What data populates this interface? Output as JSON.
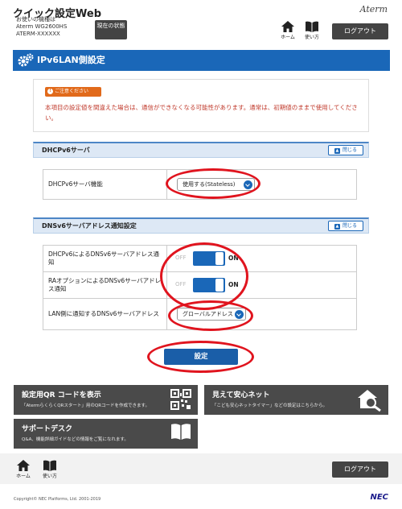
{
  "header": {
    "app_title": "クイック設定Web",
    "device_label": "お使いの機種は",
    "device_model": "Aterm WG2600HS",
    "device_id": "ATERM-XXXXXX",
    "status_button": "現在の状態",
    "brand": "Aterm",
    "home_label": "ホーム",
    "help_label": "使い方",
    "logout_label": "ログアウト"
  },
  "page_title": "IPv6LAN側設定",
  "caution": {
    "tag": "ご注意ください",
    "text": "本項目の設定値を間違えた場合は、通信ができなくなる可能性があります。通常は、初期値のままで使用してください。"
  },
  "dhcpv6": {
    "section_title": "DHCPv6サーバ",
    "close_label": "閉じる",
    "function_label": "DHCPv6サーバ機能",
    "function_value": "使用する(Stateless)"
  },
  "dnsv6": {
    "section_title": "DNSv6サーバアドレス通知設定",
    "close_label": "閉じる",
    "rows": [
      {
        "label": "DHCPv6によるDNSv6サーバアドレス通知",
        "off": "OFF",
        "on": "ON"
      },
      {
        "label": "RAオプションによるDNSv6サーバアドレス通知",
        "off": "OFF",
        "on": "ON"
      }
    ],
    "lan_notify_label": "LAN側に通知するDNSv6サーバアドレス",
    "lan_notify_value": "グローバルアドレス"
  },
  "apply_label": "設定",
  "cards": {
    "qr_title": "設定用QR コードを表示",
    "qr_sub": "「AtermらくらくQRスタート」用のQRコードを作成できます。",
    "safe_title": "見えて安心ネット",
    "safe_sub": "「こども安心ネットタイマー」などの設定はこちらから。",
    "support_title": "サポートデスク",
    "support_sub": "Q&A、機能詳細ガイドなどの情報をご覧になれます。"
  },
  "footer": {
    "home_label": "ホーム",
    "help_label": "使い方",
    "logout_label": "ログアウト",
    "copyright": "Copyright© NEC Platforms, Ltd. 2001-2019",
    "nec": "NEC"
  },
  "colors": {
    "accent": "#1a67b8",
    "caution": "#c0392b",
    "annotation": "#e0141e"
  }
}
